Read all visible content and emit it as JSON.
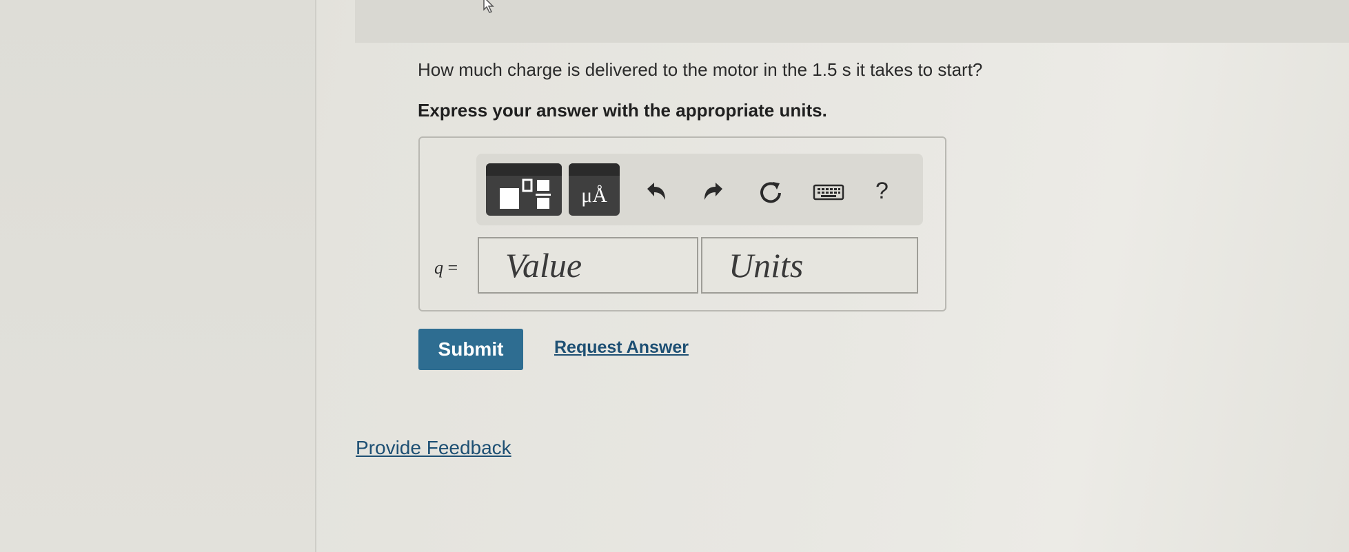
{
  "question": {
    "text": "How much charge is delivered to the motor in the 1.5 s it takes to start?",
    "instruction": "Express your answer with the appropriate units."
  },
  "toolbar": {
    "templates_icon": "fraction-template-icon",
    "units_symbol": "μÅ",
    "undo_icon": "undo-icon",
    "redo_icon": "redo-icon",
    "reset_icon": "reset-icon",
    "keyboard_icon": "keyboard-icon",
    "help_label": "?"
  },
  "answer": {
    "variable": "q",
    "equals": "=",
    "value_placeholder": "Value",
    "units_placeholder": "Units"
  },
  "actions": {
    "submit_label": "Submit",
    "request_answer_label": "Request Answer",
    "feedback_label": "Provide Feedback"
  },
  "colors": {
    "submit_bg": "#2e6d91",
    "link": "#1d4f73",
    "toolbar_button": "#3f3f3f"
  }
}
